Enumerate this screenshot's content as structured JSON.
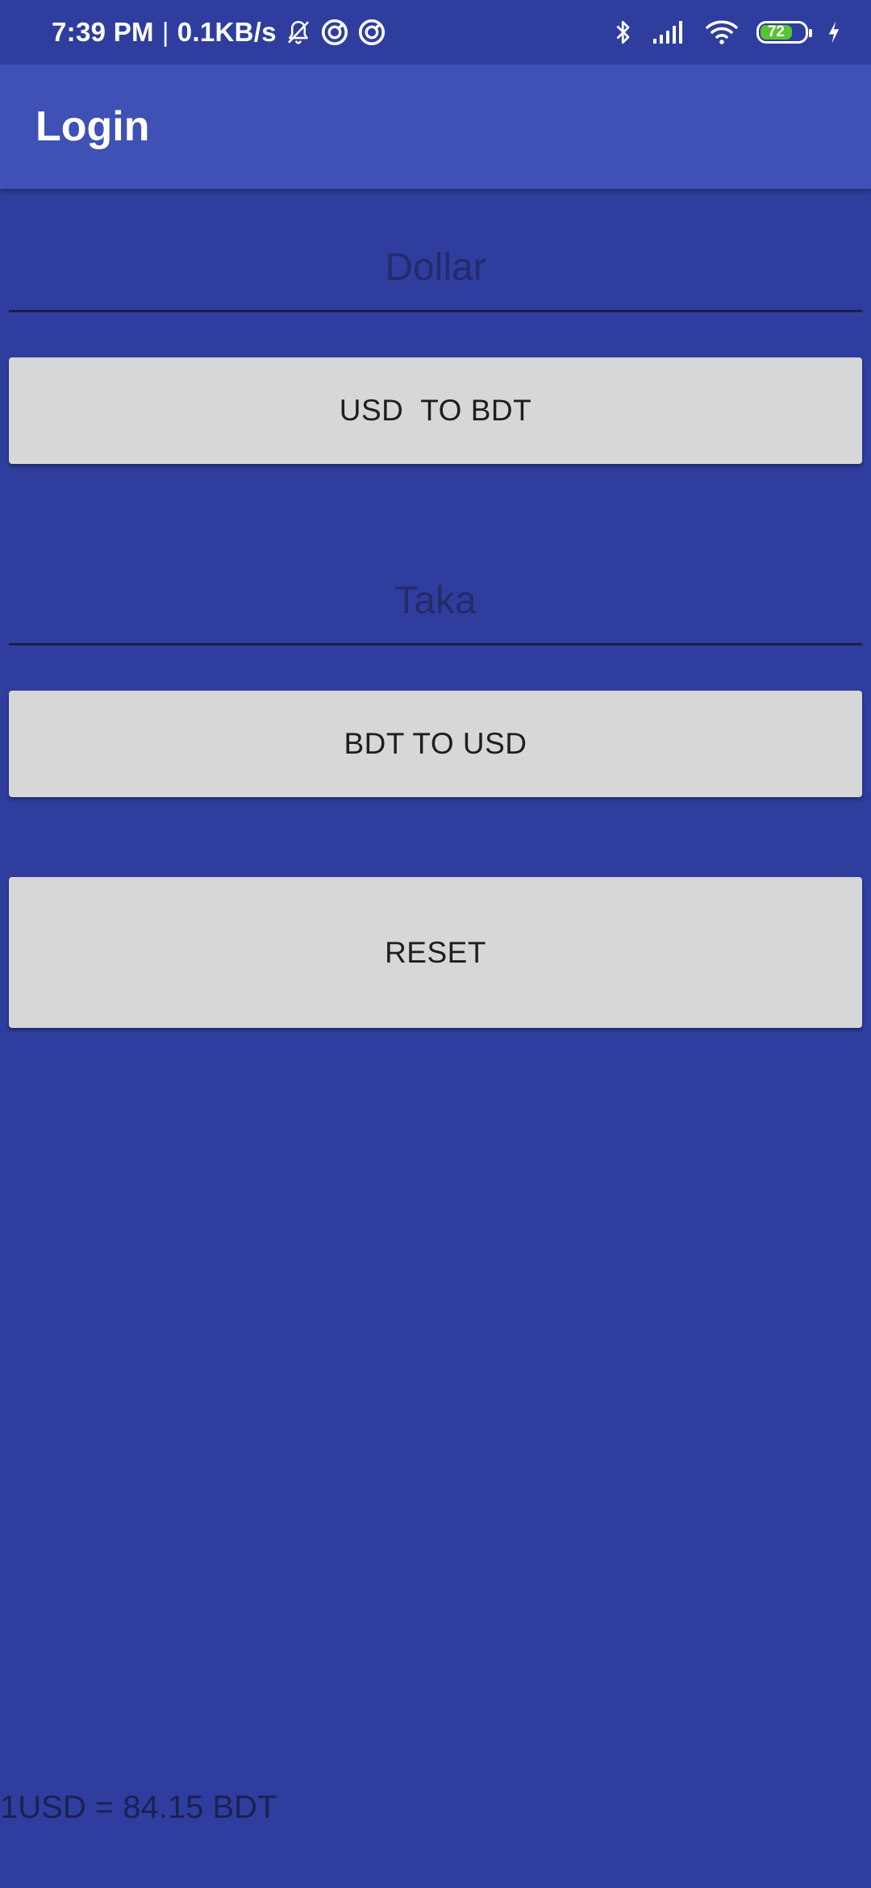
{
  "status_bar": {
    "time": "7:39 PM",
    "separator": "|",
    "network_speed": "0.1KB/s",
    "left_icons": [
      "bell-muted-icon",
      "sync-icon",
      "sync-icon"
    ],
    "right_icons": [
      "bluetooth-icon",
      "signal-icon",
      "wifi-icon",
      "battery-icon",
      "charging-icon"
    ],
    "battery_level": "72",
    "battery_color": "#5bc236"
  },
  "app_bar": {
    "title": "Login",
    "color": "#3f51b5"
  },
  "form": {
    "dollar_input": {
      "placeholder": "Dollar",
      "value": ""
    },
    "usd_to_bdt_label": "USD  TO BDT",
    "taka_input": {
      "placeholder": "Taka",
      "value": ""
    },
    "bdt_to_usd_label": "BDT TO USD",
    "reset_label": "RESET"
  },
  "footer": {
    "rate_text": "1USD = 84.15 BDT"
  },
  "colors": {
    "background": "#2f3e9e",
    "button": "#d6d7d7"
  }
}
